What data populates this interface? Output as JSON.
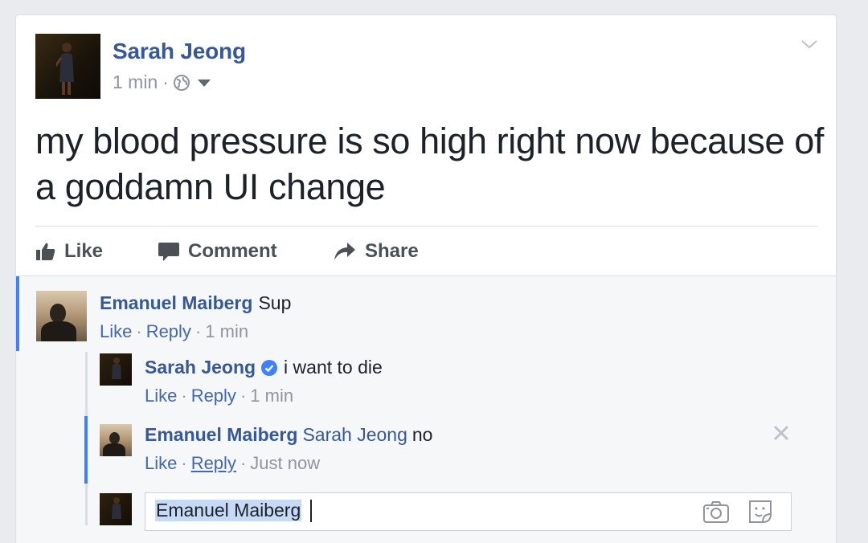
{
  "post": {
    "author": "Sarah Jeong",
    "time": "1 min",
    "separator": "·",
    "privacy_icon": "globe-icon",
    "text": "my blood pressure is so high right now because of a goddamn UI change"
  },
  "actions": {
    "like": "Like",
    "comment": "Comment",
    "share": "Share"
  },
  "comments": [
    {
      "author": "Emanuel Maiberg",
      "text": "Sup",
      "like": "Like",
      "reply": "Reply",
      "time": "1 min"
    },
    {
      "author": "Sarah Jeong",
      "verified": true,
      "text": "i want to die",
      "like": "Like",
      "reply": "Reply",
      "time": "1 min"
    },
    {
      "author": "Emanuel Maiberg",
      "mention": "Sarah Jeong",
      "text": "no",
      "like": "Like",
      "reply": "Reply",
      "time": "Just now"
    }
  ],
  "reply_input": {
    "value": "Emanuel Maiberg"
  },
  "colors": {
    "link_blue": "#365899",
    "accent_blue": "#4080ff",
    "meta_gray": "#90949c"
  }
}
